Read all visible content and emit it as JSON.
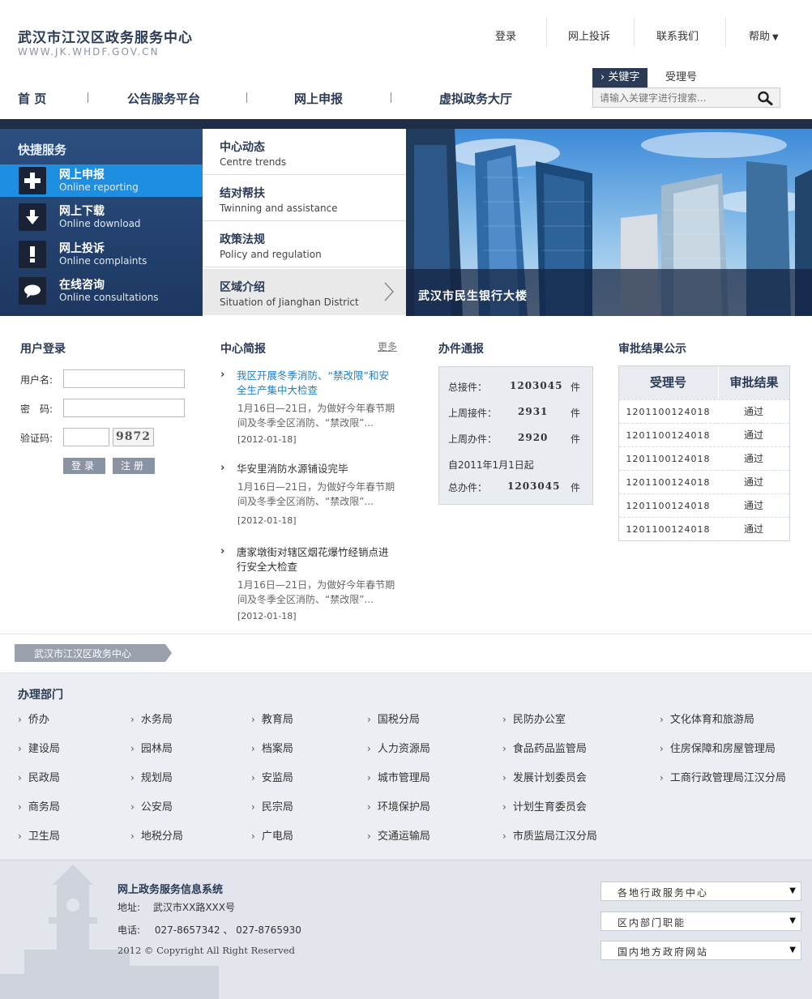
{
  "header": {
    "site_title": "武汉市江汉区政务服务中心",
    "site_url": "WWW.JK.WHDF.GOV.CN",
    "top_links": {
      "login": "登录",
      "complaint": "网上投诉",
      "contact": "联系我们",
      "help": "帮助"
    },
    "nav": {
      "home": "首 页",
      "notice": "公告服务平台",
      "apply": "网上申报",
      "virtual": "虚拟政务大厅"
    },
    "search": {
      "tab_keyword": "关键字",
      "tab_number": "受理号",
      "placeholder": "请输入关键字进行搜索..."
    }
  },
  "quick_service": {
    "title": "快捷服务",
    "items": [
      {
        "cn": "网上申报",
        "en": "Online reporting",
        "icon": "plus-icon"
      },
      {
        "cn": "网上下载",
        "en": "Online download",
        "icon": "download-arrow-icon"
      },
      {
        "cn": "网上投诉",
        "en": "Online complaints",
        "icon": "exclamation-icon"
      },
      {
        "cn": "在线咨询",
        "en": "Online consultations",
        "icon": "chat-bubble-icon"
      }
    ]
  },
  "center_menu": [
    {
      "cn": "中心动态",
      "en": "Centre trends"
    },
    {
      "cn": "结对帮扶",
      "en": "Twinning and assistance"
    },
    {
      "cn": "政策法规",
      "en": "Policy and regulation"
    },
    {
      "cn": "区域介绍",
      "en": "Situation of Jianghan District"
    }
  ],
  "banner": {
    "caption": "武汉市民生银行大楼"
  },
  "login": {
    "title": "用户登录",
    "username_label": "用户名:",
    "password_label": "密　码:",
    "captcha_label": "验证码:",
    "captcha_code": "9872",
    "login_btn": "登录",
    "register_btn": "注册"
  },
  "news": {
    "title": "中心简报",
    "more": "更多",
    "items": [
      {
        "title": "我区开展冬季消防、“禁改限”和安全生产集中大检查",
        "summary": "1月16日—21日，为做好今年春节期间及冬季全区消防、“禁改限”...",
        "date": "[2012-01-18]"
      },
      {
        "title": "华安里消防水源铺设完毕",
        "summary": "1月16日—21日，为做好今年春节期间及冬季全区消防、“禁改限”...",
        "date": "[2012-01-18]"
      },
      {
        "title": "唐家墩街对辖区烟花爆竹经销点进行安全大检查",
        "summary": "1月16日—21日，为做好今年春节期间及冬季全区消防、“禁改限”...",
        "date": "[2012-01-18]"
      }
    ]
  },
  "stats": {
    "title": "办件通报",
    "total_received_label": "总接件：",
    "total_received": "1203045",
    "last_week_received_label": "上周接件：",
    "last_week_received": "2931",
    "last_week_done_label": "上周办件：",
    "last_week_done": "2920",
    "since_label": "自2011年1月1日起",
    "total_done_label": "总办件：",
    "total_done": "1203045",
    "unit": "件"
  },
  "results": {
    "title": "审批结果公示",
    "col_number": "受理号",
    "col_result": "审批结果",
    "rows": [
      {
        "number": "1201100124018",
        "result": "通过"
      },
      {
        "number": "1201100124018",
        "result": "通过"
      },
      {
        "number": "1201100124018",
        "result": "通过"
      },
      {
        "number": "1201100124018",
        "result": "通过"
      },
      {
        "number": "1201100124018",
        "result": "通过"
      },
      {
        "number": "1201100124018",
        "result": "通过"
      }
    ]
  },
  "breadcrumb": {
    "label": "武汉市江汉区政务中心"
  },
  "departments": {
    "title": "办理部门",
    "items": [
      "侨办",
      "水务局",
      "教育局",
      "国税分局",
      "民防办公室",
      "文化体育和旅游局",
      "建设局",
      "园林局",
      "档案局",
      "人力资源局",
      "食品药品监管局",
      "住房保障和房屋管理局",
      "民政局",
      "规划局",
      "安监局",
      "城市管理局",
      "发展计划委员会",
      "工商行政管理局江汉分局",
      "商务局",
      "公安局",
      "民宗局",
      "环境保护局",
      "计划生育委员会",
      "卫生局",
      "地税分局",
      "广电局",
      "交通运输局",
      "市质监局江汉分局"
    ]
  },
  "footer": {
    "system_name": "网上政务服务信息系统",
    "address_label": "地址:",
    "address": "武汉市XX路XXX号",
    "phone_label": "电话:",
    "phones": "027-8657342 、 027-8765930",
    "copyright": "2012 © Copyright All Right Reserved",
    "selects": [
      "各地行政服务中心",
      "区内部门职能",
      "国内地方政府网站"
    ]
  },
  "colors": {
    "brand_navy": "#2b3a55",
    "accent_blue": "#1e8fe0",
    "link_blue": "#1f7fc4"
  }
}
